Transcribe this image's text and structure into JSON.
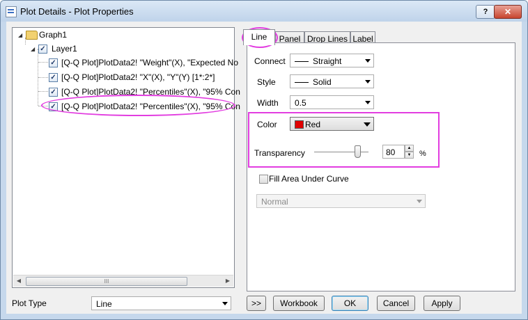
{
  "window": {
    "title": "Plot Details - Plot Properties",
    "help_glyph": "?",
    "close_glyph": "✕"
  },
  "tree": {
    "root_label": "Graph1",
    "layer_label": "Layer1",
    "items": [
      "[Q-Q Plot]PlotData2! \"Weight\"(X), \"Expected No",
      "[Q-Q Plot]PlotData2! \"X\"(X), \"Y\"(Y) [1*:2*]",
      "[Q-Q Plot]PlotData2! \"Percentiles\"(X), \"95% Con",
      "[Q-Q Plot]PlotData2! \"Percentiles\"(X), \"95% Con"
    ],
    "check_glyph": "✓",
    "scroll_thumb_grip": "III"
  },
  "plot_type": {
    "label": "Plot Type",
    "value": "Line"
  },
  "tabs": [
    "Line",
    "Panel",
    "Drop Lines",
    "Label"
  ],
  "line_tab": {
    "connect_label": "Connect",
    "connect_value": "Straight",
    "style_label": "Style",
    "style_value": "Solid",
    "width_label": "Width",
    "width_value": "0.5",
    "color_label": "Color",
    "color_value": "Red",
    "color_swatch": "#e00000",
    "transparency_label": "Transparency",
    "transparency_value": "80",
    "transparency_unit": "%",
    "transparency_slider": 0.8,
    "fill_label": "Fill Area Under Curve",
    "fill_checked": false,
    "fill_mode_value": "Normal"
  },
  "buttons": {
    "expand": ">>",
    "workbook": "Workbook",
    "ok": "OK",
    "cancel": "Cancel",
    "apply": "Apply"
  },
  "highlight_color": "#e23de0"
}
